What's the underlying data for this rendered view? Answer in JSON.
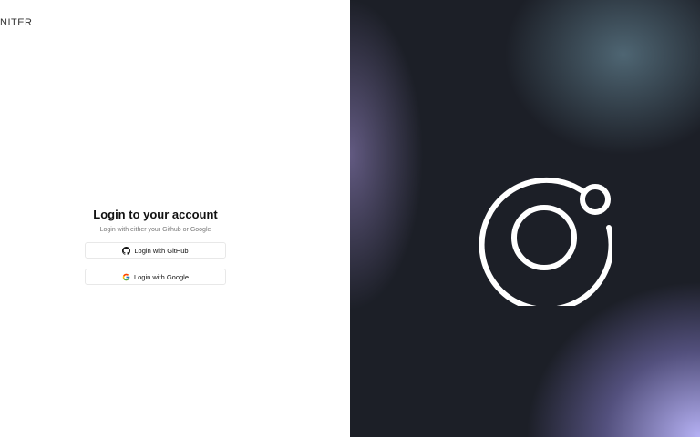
{
  "brand": {
    "name": "NITER"
  },
  "login": {
    "title": "Login to your account",
    "subtitle": "Login with either your Github or Google",
    "github_label": "Login with GitHub",
    "google_label": "Login with Google"
  },
  "icons": {
    "github": "github-icon",
    "google": "google-icon",
    "logo": "ionic-logo-icon"
  },
  "colors": {
    "panel_dark": "#1c1f27",
    "accent_lavender": "#bebaff",
    "accent_teal": "#5f7d8c",
    "button_border": "#e8e8e8"
  }
}
